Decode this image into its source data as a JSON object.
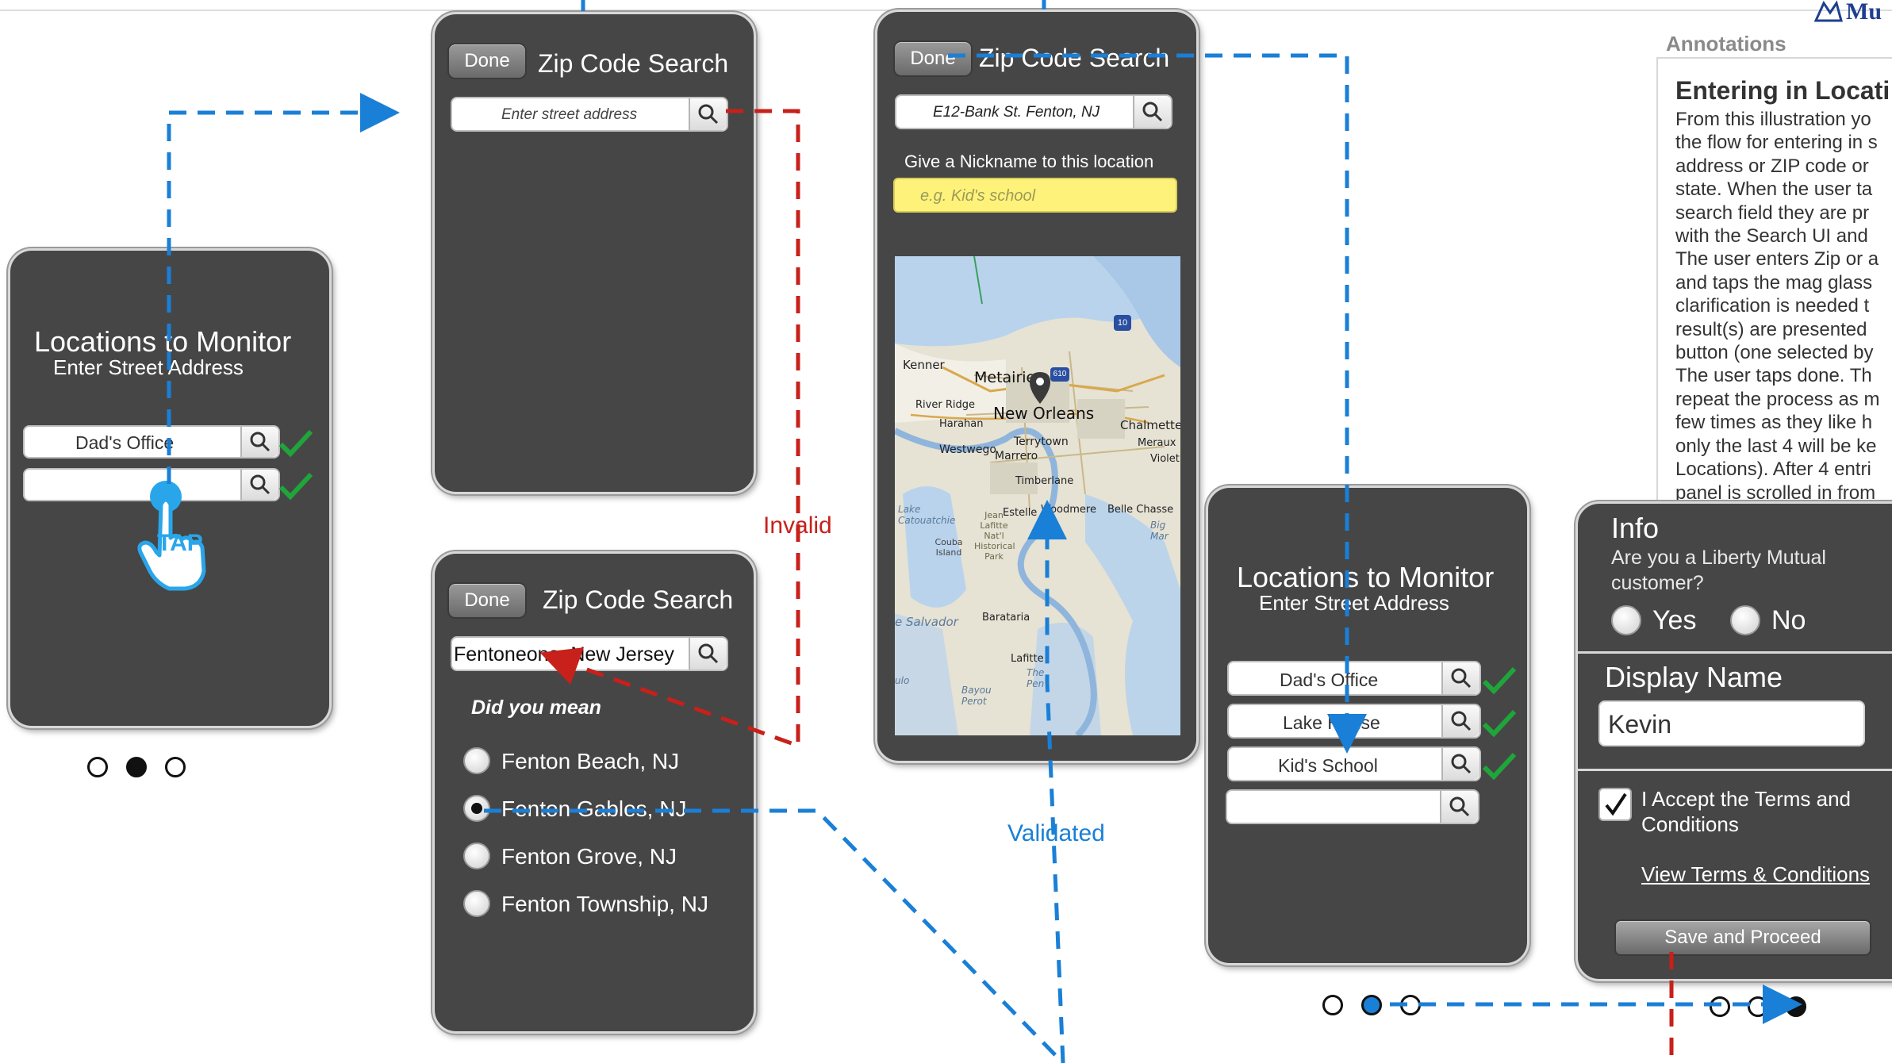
{
  "annotations_panel": {
    "header": "Annotations",
    "title": "Entering in Locati",
    "lines": [
      "From this illustration yo",
      "the flow for entering in s",
      "address or ZIP code or",
      "state. When the user ta",
      "search field they are pr",
      "with the Search UI and",
      "The user enters Zip or a",
      "and taps the mag glass",
      "clarification is needed t",
      "result(s) are presented",
      "button (one selected by",
      "The user taps done. Th",
      "repeat the process as m",
      "few times as they like h",
      "only the last 4 will be ke",
      "Locations). After 4 entri",
      "panel is scrolled in from"
    ],
    "logo_text": "Mu"
  },
  "screen1": {
    "title": "Locations to Monitor",
    "subtitle": "Enter Street Address",
    "field1_value": "Dad's Office",
    "field2_value": "",
    "tap_label": "TAP"
  },
  "screen2": {
    "done_label": "Done",
    "title": "Zip Code Search",
    "search_placeholder": "Enter street address"
  },
  "screen3": {
    "done_label": "Done",
    "title": "Zip Code Search",
    "search_value": "Fentoneone, New Jersey",
    "did_you_mean": "Did you mean",
    "options": [
      "Fenton Beach, NJ",
      "Fenton Gables, NJ",
      "Fenton Grove, NJ",
      "Fenton Township, NJ"
    ],
    "selected_index": 1
  },
  "screen4": {
    "done_label": "Done",
    "title": "Zip Code Search",
    "search_value": "E12-Bank St. Fenton, NJ",
    "nickname_label": "Give a Nickname to this location",
    "nickname_placeholder": "e.g. Kid's school",
    "map_labels": {
      "kenner": "Kenner",
      "metairie": "Metairie",
      "river_ridge": "River Ridge",
      "harahan": "Harahan",
      "new_orleans": "New Orleans",
      "chalmette": "Chalmette",
      "westwego": "Westwego",
      "terrytown": "Terrytown",
      "marrero": "Marrero",
      "meraux": "Meraux",
      "violet": "Violet",
      "timberlane": "Timberlane",
      "lake_catouatchie": "Lake Catouatchie",
      "estelle": "Estelle",
      "woodmere": "Woodmere",
      "belle_chasse": "Belle Chasse",
      "jean_lafitte": "Jean Lafitte Nat'l Historical Park",
      "couba": "Couba Island",
      "big_mar": "Big Mar",
      "salvador": "e Salvador",
      "barataria": "Barataria",
      "lafitte": "Lafitte",
      "the_pen": "The Pen",
      "bayou_perot": "Bayou Perot",
      "ulo": "ulo",
      "i10": "10",
      "i610": "610"
    }
  },
  "screen5": {
    "title": "Locations to Monitor",
    "subtitle": "Enter Street Address",
    "fields": [
      "Dad's Office",
      "Lake House",
      "Kid's School",
      ""
    ]
  },
  "screen6": {
    "info_title": "Info",
    "info_question": "Are you a Liberty Mutual customer?",
    "yes_label": "Yes",
    "no_label": "No",
    "display_name_label": "Display Name",
    "display_name_value": "Kevin",
    "accept_label": "I Accept the Terms and Conditions",
    "terms_link": "View Terms & Conditions",
    "save_button": "Save and Proceed"
  },
  "flow_labels": {
    "invalid": "Invalid",
    "validated": "Validated"
  },
  "pagination": {
    "left_active_index": 1,
    "mid_active_index": 1,
    "right_active_index": 2
  },
  "colors": {
    "phone_bg": "#464646",
    "flow_blue": "#1a7fd6",
    "flow_red": "#c8201a",
    "check_green": "#1fa53a",
    "nickname_yellow": "#fff27a"
  }
}
